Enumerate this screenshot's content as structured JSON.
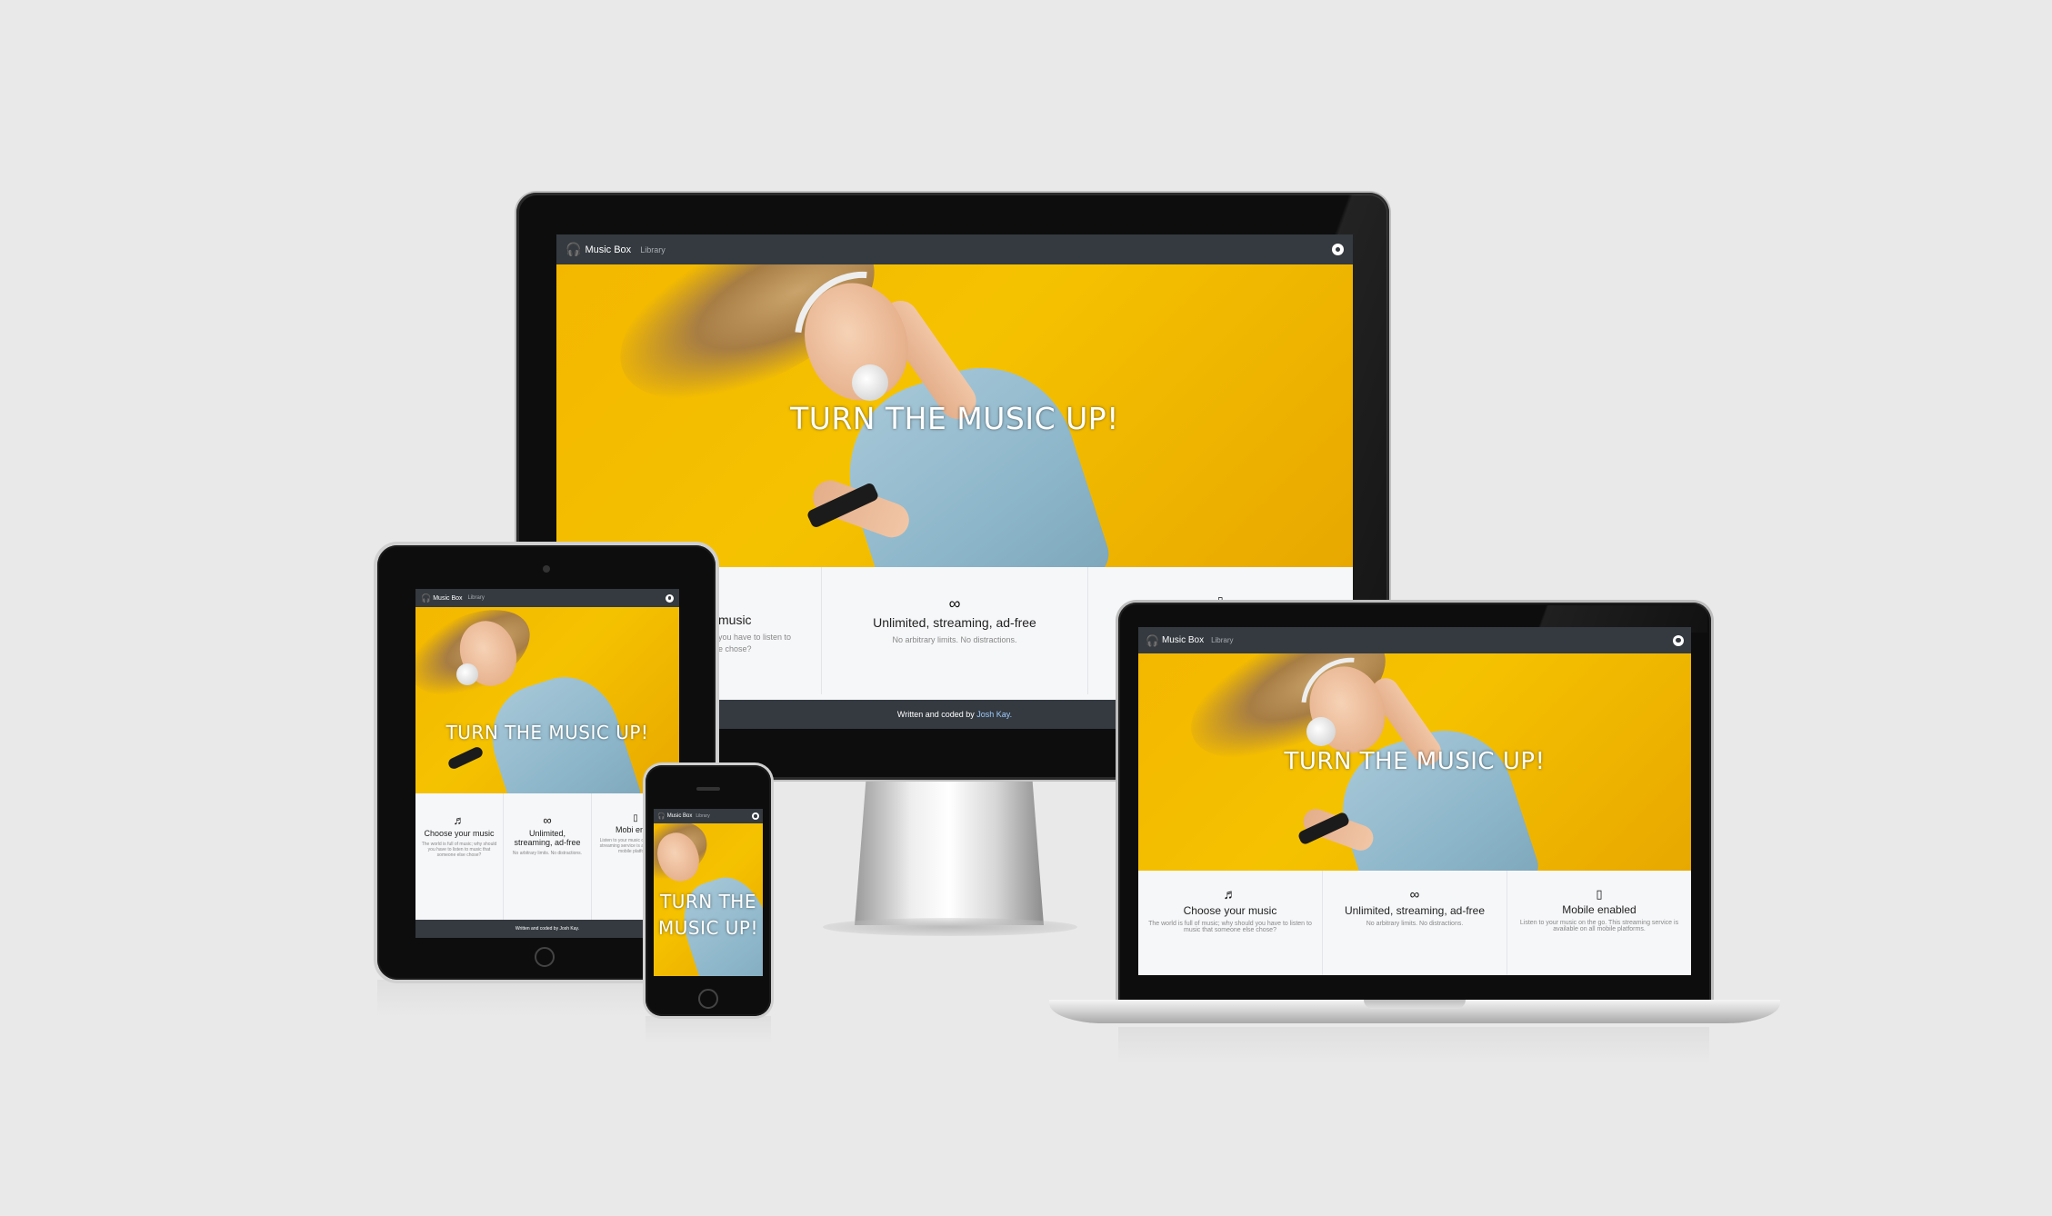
{
  "site": {
    "brand": "Music Box",
    "nav_link": "Library",
    "hero_title": "TURN THE MUSIC UP!",
    "features": [
      {
        "icon": "music-note-icon",
        "glyph": "♬",
        "heading": "Choose your music",
        "text": "The world is full of music; why should you have to listen to music that someone else chose?"
      },
      {
        "icon": "infinity-icon",
        "glyph": "∞",
        "heading": "Unlimited, streaming, ad-free",
        "text": "No arbitrary limits. No distractions."
      },
      {
        "icon": "mobile-icon",
        "glyph": "▯",
        "heading": "Mobile enabled",
        "text": "Listen to your music on the go. This streaming service is available on all mobile platforms."
      }
    ],
    "footer_prefix": "Written and coded by",
    "footer_author": "Josh Kay."
  },
  "desktop_visible": {
    "feature1_heading_fragment": "music",
    "feature1_text_line1": "you have to listen to",
    "feature1_text_line2": "e chose?"
  },
  "tablet_visible": {
    "feature1_heading": "Choose your music",
    "feature2_heading": "Unlimited, streaming, ad-free",
    "feature3_heading_fragment": "Mobi enabl",
    "footer_text": "Written and coded by Josh Kay."
  },
  "phone_visible": {
    "hero_title": "TURN THE MUSIC UP!"
  },
  "colors": {
    "background": "#e9e9e9",
    "navbar": "#343a40",
    "hero_yellow": "#f3b700",
    "features_bg": "#f6f7f9",
    "footer_link": "#9ecbff"
  }
}
